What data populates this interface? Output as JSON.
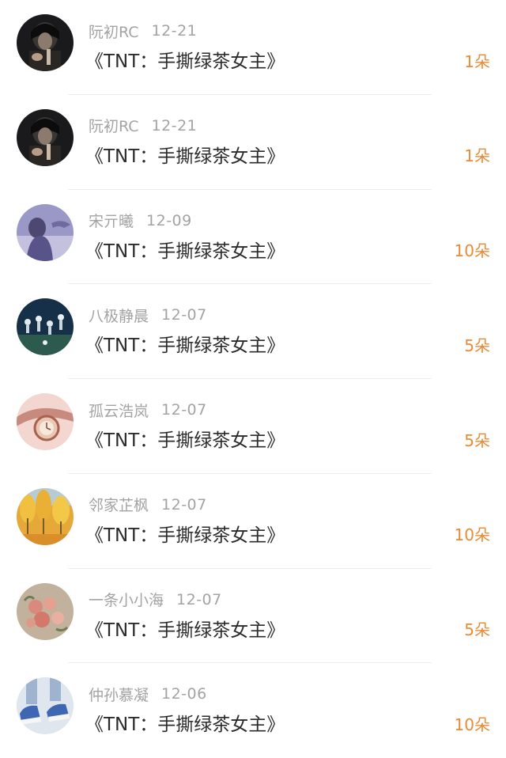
{
  "items": [
    {
      "user": "阮初RC",
      "date": "12-21",
      "title": "《TNT：手撕绿茶女主》",
      "count": "1朵",
      "avatar": "dark-portrait-icon"
    },
    {
      "user": "阮初RC",
      "date": "12-21",
      "title": "《TNT：手撕绿茶女主》",
      "count": "1朵",
      "avatar": "dark-portrait-icon"
    },
    {
      "user": "宋亓曦",
      "date": "12-09",
      "title": "《TNT：手撕绿茶女主》",
      "count": "10朵",
      "avatar": "purple-figure-icon"
    },
    {
      "user": "八极静晨",
      "date": "12-07",
      "title": "《TNT：手撕绿茶女主》",
      "count": "5朵",
      "avatar": "night-scene-icon"
    },
    {
      "user": "孤云浩岚",
      "date": "12-07",
      "title": "《TNT：手撕绿茶女主》",
      "count": "5朵",
      "avatar": "watch-photo-icon"
    },
    {
      "user": "邻家芷枫",
      "date": "12-07",
      "title": "《TNT：手撕绿茶女主》",
      "count": "10朵",
      "avatar": "autumn-trees-icon"
    },
    {
      "user": "一条小小海",
      "date": "12-07",
      "title": "《TNT：手撕绿茶女主》",
      "count": "5朵",
      "avatar": "roses-icon"
    },
    {
      "user": "仲孙慕凝",
      "date": "12-06",
      "title": "《TNT：手撕绿茶女主》",
      "count": "10朵",
      "avatar": "sneakers-icon"
    }
  ],
  "colors": {
    "count": "#ec8a33",
    "meta": "#a3a3a3",
    "title": "#2b2b2b"
  }
}
